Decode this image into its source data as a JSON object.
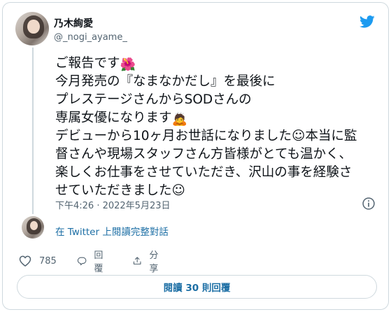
{
  "author": {
    "display_name": "乃木絢愛",
    "handle": "@_nogi_ayame_"
  },
  "tweet": {
    "lines": [
      {
        "text": "ご報告です",
        "emoji": "🌺"
      },
      {
        "text": "今月発売の『なまなかだし』を最後に",
        "emoji": ""
      },
      {
        "text": "プレステージさんからSODさんの",
        "emoji": ""
      },
      {
        "text": "専属女優になります",
        "emoji": "🙇"
      },
      {
        "text": "デビューから10ヶ月お世話になりました☺本当に監",
        "emoji": ""
      },
      {
        "text": "督さんや現場スタッフさん方皆様がとても温かく、",
        "emoji": ""
      },
      {
        "text": "楽しくお仕事をさせていただき、沢山の事を経験さ",
        "emoji": ""
      },
      {
        "text": "せていただきました☺",
        "emoji": ""
      }
    ],
    "timestamp": "下午4:26 · 2022年5月23日"
  },
  "thread_link": "在 Twitter 上閱讀完整對話",
  "actions": {
    "like_count": "785",
    "reply_label": "回覆",
    "share_label": "分享"
  },
  "read_replies": "閱讀 30 則回覆",
  "colors": {
    "twitter_blue": "#1d9bf0",
    "link_blue": "#1d6fa5",
    "secondary_text": "#536471",
    "border": "#cfd9de"
  },
  "icons": [
    "twitter-bird-icon",
    "info-icon",
    "heart-icon",
    "reply-icon",
    "share-icon"
  ]
}
